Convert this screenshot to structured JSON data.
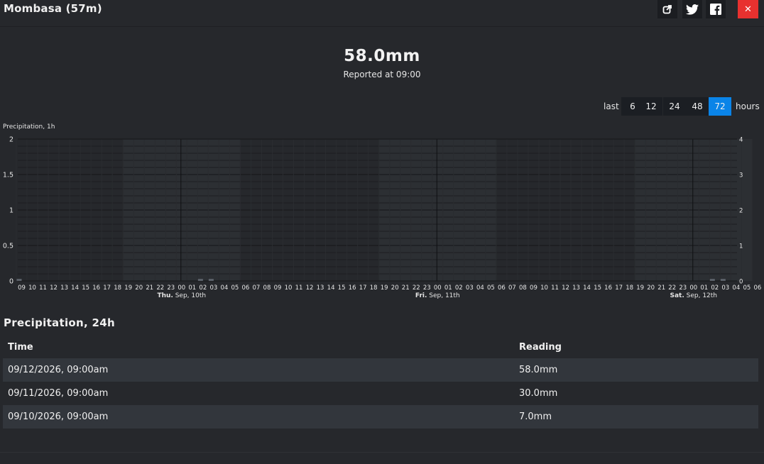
{
  "header": {
    "title": "Mombasa (57m)",
    "share_icon": "external-share-icon",
    "twitter_icon": "twitter-icon",
    "facebook_icon": "facebook-icon",
    "close_label": "✕"
  },
  "summary": {
    "reading": "58.0mm",
    "reported": "Reported at 09:00"
  },
  "range": {
    "prefix": "last",
    "options": [
      "6",
      "12",
      "24",
      "48",
      "72"
    ],
    "selected": "72",
    "suffix": "hours"
  },
  "colors": {
    "accent": "#0a84e8",
    "close": "#e8312f",
    "background": "#26282c",
    "night_shade": "#2c2f33",
    "bar": "#5a6068"
  },
  "chart_data": {
    "type": "bar",
    "title": "Precipitation, 1h",
    "y_left_ticks": [
      "0",
      "0.5",
      "1",
      "1.5",
      "2"
    ],
    "y_right_ticks": [
      "0",
      "1",
      "2",
      "3",
      "4"
    ],
    "ylim": [
      0,
      2
    ],
    "y_right_lim": [
      0,
      4
    ],
    "x_hour_labels": [
      "09",
      "10",
      "11",
      "12",
      "13",
      "14",
      "15",
      "16",
      "17",
      "18",
      "19",
      "20",
      "21",
      "22",
      "23",
      "00",
      "01",
      "02",
      "03",
      "04",
      "05",
      "06",
      "07",
      "08",
      "09",
      "10",
      "11",
      "12",
      "13",
      "14",
      "15",
      "16",
      "17",
      "18",
      "19",
      "20",
      "21",
      "22",
      "23",
      "00",
      "01",
      "02",
      "03",
      "04",
      "05",
      "06",
      "07",
      "08",
      "09",
      "10",
      "11",
      "12",
      "13",
      "14",
      "15",
      "16",
      "17",
      "18",
      "19",
      "20",
      "21",
      "22",
      "23",
      "00",
      "01",
      "02",
      "03",
      "04",
      "05",
      "06"
    ],
    "day_labels": [
      {
        "day": "Thu.",
        "date": " Sep, 10th",
        "hour_index": 15
      },
      {
        "day": "Fri.",
        "date": " Sep, 11th",
        "hour_index": 39
      },
      {
        "day": "Sat.",
        "date": " Sep, 12th",
        "hour_index": 63
      }
    ],
    "night_ranges": [
      [
        10,
        21
      ],
      [
        34,
        45
      ],
      [
        58,
        69
      ]
    ],
    "values": [
      0.03,
      0,
      0,
      0,
      0,
      0,
      0,
      0,
      0,
      0,
      0,
      0,
      0,
      0,
      0,
      0,
      0,
      0.03,
      0.03,
      0,
      0,
      0,
      0,
      0,
      0,
      0,
      0,
      0,
      0,
      0,
      0,
      0,
      0,
      0,
      0,
      0,
      0,
      0,
      0,
      0,
      0,
      0,
      0,
      0,
      0,
      0,
      0,
      0,
      0,
      0,
      0,
      0,
      0,
      0,
      0,
      0,
      0,
      0,
      0,
      0,
      0,
      0,
      0,
      0,
      0,
      0.03,
      0.03,
      0,
      0,
      0,
      0,
      0
    ],
    "grid": true
  },
  "table": {
    "title": "Precipitation, 24h",
    "columns": [
      "Time",
      "Reading"
    ],
    "rows": [
      [
        "09/12/2026, 09:00am",
        "58.0mm"
      ],
      [
        "09/11/2026, 09:00am",
        "30.0mm"
      ],
      [
        "09/10/2026, 09:00am",
        "7.0mm"
      ]
    ]
  }
}
